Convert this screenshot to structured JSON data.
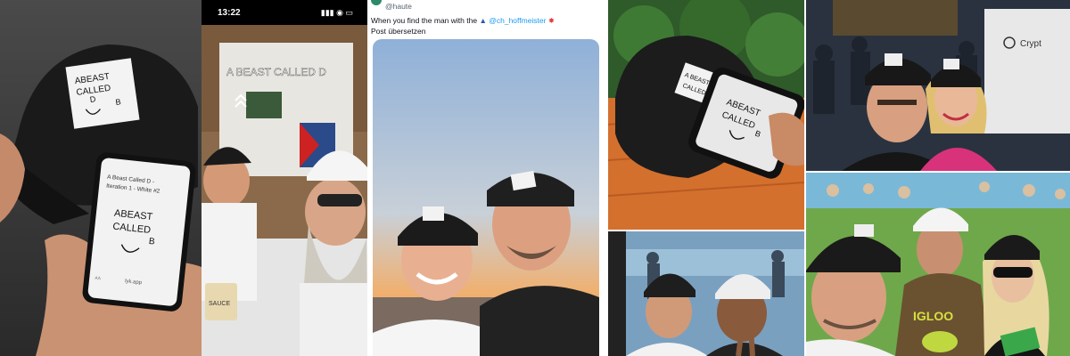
{
  "panel1": {
    "cap_label": {
      "line1": "ABEAST",
      "line2": "CALLED",
      "line3": "D",
      "letter": "B"
    },
    "phone": {
      "title_line1": "A Beast Called D -",
      "title_line2": "Iteration 1 - White #2",
      "art_line1": "ABEAST",
      "art_line2": "CALLED",
      "art_letter": "B",
      "url": "lyk.app",
      "aa": "AA"
    }
  },
  "panel2": {
    "time": "13:22",
    "story_title": "A BEAST CALLED D",
    "cup_label": "SAUCE"
  },
  "panel3": {
    "handle": "@haute",
    "tweet_prefix": "When you find the man with the",
    "tweet_mention": "@ch_hoffmeister",
    "translate": "Post übersetzen"
  },
  "panel4": {
    "phone_art_line1": "ABEAST",
    "phone_art_line2": "CALLED",
    "phone_art_letter": "B"
  },
  "panel5": {
    "booth_text": "Crypt"
  },
  "panel7": {
    "hoodie_text": "IGLOO"
  },
  "colors": {
    "tweet_link": "#1d9bf0",
    "cap_black": "#1a1a1a",
    "jacket_pink": "#d8327a",
    "sky_blue": "#8fb0d8",
    "sunset": "#f0b070"
  }
}
